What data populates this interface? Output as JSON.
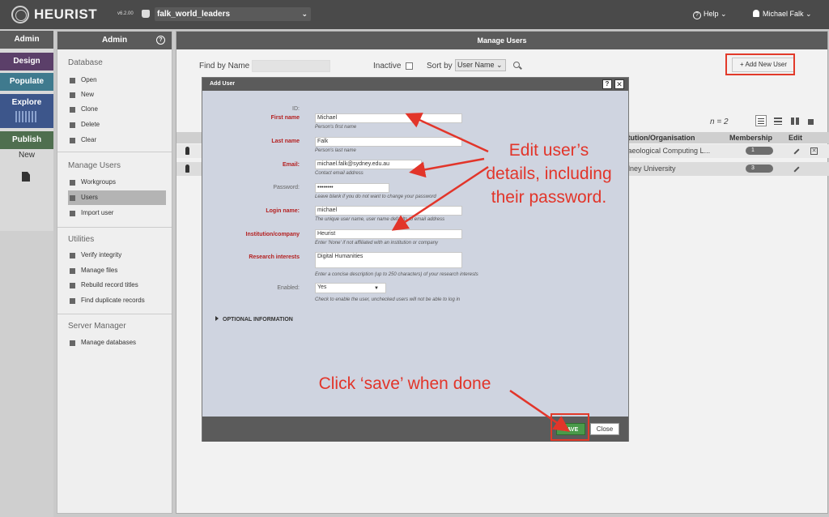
{
  "topbar": {
    "logo_text": "HEURIST",
    "version": "v6.2.00",
    "database_name": "falk_world_leaders",
    "help_label": "Help ⌄",
    "help_icon": "?",
    "user_label": "Michael Falk ⌄",
    "chevron": "⌄"
  },
  "leftnav": {
    "admin": "Admin",
    "design": "Design",
    "populate": "Populate",
    "explore": "Explore",
    "publish": "Publish",
    "new": "New"
  },
  "adminpanel": {
    "title": "Admin",
    "help_icon": "?",
    "sections": {
      "database": "Database",
      "manage_users": "Manage Users",
      "utilities": "Utilities",
      "server_manager": "Server Manager"
    },
    "database_items": [
      "Open",
      "New",
      "Clone",
      "Delete",
      "Clear"
    ],
    "manage_users_items": [
      "Workgroups",
      "Users",
      "Import user"
    ],
    "utilities_items": [
      "Verify integrity",
      "Manage files",
      "Rebuild record titles",
      "Find duplicate records"
    ],
    "server_items": [
      "Manage databases"
    ]
  },
  "main": {
    "title": "Manage Users",
    "find_by_label": "Find by Name",
    "inactive_label": "Inactive",
    "sortby_label": "Sort by",
    "sortby_value": "User Name ⌄",
    "add_user_label": "+ Add New User",
    "count": "n = 2",
    "columns": {
      "institution": "stitution/Organisation",
      "membership": "Membership",
      "edit": "Edit"
    },
    "rows": [
      {
        "institution": "rchaeological Computing L...",
        "membership": "1"
      },
      {
        "institution": "dney University",
        "membership": "3"
      }
    ],
    "delete_icon": "✕"
  },
  "dialog": {
    "title": "Add User",
    "help_icon": "?",
    "close_icon": "✕",
    "fields": {
      "id_label": "ID:",
      "first_name_label": "First name",
      "first_name_value": "Michael",
      "first_name_hint": "Person's first name",
      "last_name_label": "Last name",
      "last_name_value": "Falk",
      "last_name_hint": "Person's last name",
      "email_label": "Email:",
      "email_value": "michael.falk@sydney.edu.au",
      "email_hint": "Contact email address",
      "password_label": "Password:",
      "password_value": "••••••••",
      "password_hint": "Leave blank if you do not want to change your password",
      "login_label": "Login name:",
      "login_value": "michael",
      "login_hint": "The unique user name, user name defaults to email address",
      "institution_label": "Institution/company",
      "institution_value": "Heurist",
      "institution_hint": "Enter 'None' if not affiliated with an institution or company",
      "research_label": "Research interests",
      "research_value": "Digital Humanities",
      "research_hint": "Enter a concise description (up to 250 characters) of your research interests",
      "enabled_label": "Enabled:",
      "enabled_value": "Yes",
      "enabled_hint": "Check to enable the user, unchecked users will not be able to log in",
      "dropdown_arrow": "▼"
    },
    "optional_info": "OPTIONAL INFORMATION",
    "save_label": "SAVE",
    "close_label": "Close"
  },
  "annotations": {
    "edit_line1": "Edit user’s",
    "edit_line2": "details, including",
    "edit_line3": "their password.",
    "save_note": "Click ‘save’ when done"
  },
  "colors": {
    "annotation": "#e2352a",
    "topbar": "#4a4a4a",
    "design": "#5b3f69",
    "populate": "#3f7a8e",
    "explore": "#3d568b",
    "publish": "#4f6f4f",
    "save": "#4a9a4a"
  }
}
